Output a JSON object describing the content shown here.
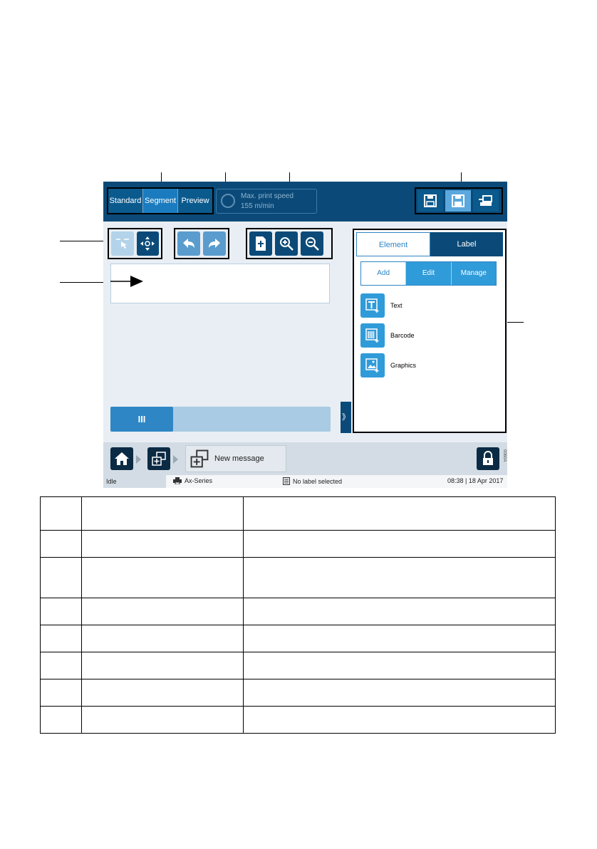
{
  "topbar": {
    "modes": [
      "Standard",
      "Segment",
      "Preview"
    ],
    "active_mode": "Segment",
    "speed_line1": "Max. print speed",
    "speed_line2": "155 m/min"
  },
  "toolbar": {
    "save_icon": "save-icon",
    "save_as_icon": "save-as-icon",
    "print_icon": "send-to-printer-icon",
    "select_icon": "select-touch-icon",
    "move_icon": "move-icon",
    "undo_icon": "undo-icon",
    "redo_icon": "redo-icon",
    "fit_icon": "fit-to-page-icon",
    "zoom_in_icon": "zoom-in-icon",
    "zoom_out_icon": "zoom-out-icon"
  },
  "scrollbar": {
    "thumb_label": "III",
    "position": 0.28
  },
  "expand_label": "》",
  "panel": {
    "tabs": [
      "Element",
      "Label"
    ],
    "active_tab": "Label",
    "subtabs": [
      "Add",
      "Edit",
      "Manage"
    ],
    "items": [
      {
        "label": "Text",
        "icon": "text-add-icon"
      },
      {
        "label": "Barcode",
        "icon": "barcode-add-icon"
      },
      {
        "label": "Graphics",
        "icon": "graphics-add-icon"
      }
    ]
  },
  "bottom_nav": {
    "message_label": "New message",
    "code": "0060A"
  },
  "statusbar": {
    "state": "Idle",
    "printer": "Ax-Series",
    "label": "No label selected",
    "datetime": "08:38 | 18 Apr 2017"
  },
  "key_table": {
    "row_count": 8
  },
  "colors": {
    "topbar": "#0b4a78",
    "accent": "#2f9bd9",
    "screen_bg": "#e8eef4"
  }
}
